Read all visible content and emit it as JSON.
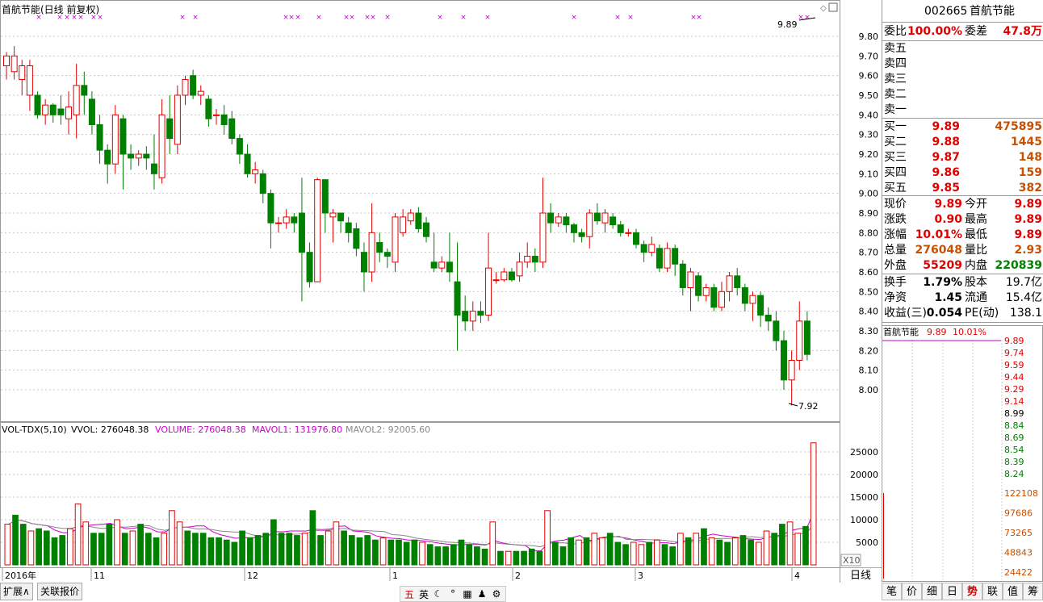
{
  "chart_title": "首航节能(日线 前复权)",
  "stock": {
    "code": "002665",
    "name": "首航节能"
  },
  "weibi": {
    "label": "委比",
    "value": "100.00%",
    "label2": "委差",
    "value2": "47.8万"
  },
  "asks": [
    {
      "label": "卖五"
    },
    {
      "label": "卖四"
    },
    {
      "label": "卖三"
    },
    {
      "label": "卖二"
    },
    {
      "label": "卖一"
    }
  ],
  "bids": [
    {
      "label": "买一",
      "price": "9.89",
      "vol": "475895"
    },
    {
      "label": "买二",
      "price": "9.88",
      "vol": "1445"
    },
    {
      "label": "买三",
      "price": "9.87",
      "vol": "148"
    },
    {
      "label": "买四",
      "price": "9.86",
      "vol": "159"
    },
    {
      "label": "买五",
      "price": "9.85",
      "vol": "382"
    }
  ],
  "quote": [
    {
      "l1": "现价",
      "v1": "9.89",
      "l2": "今开",
      "v2": "9.89"
    },
    {
      "l1": "涨跌",
      "v1": "0.90",
      "l2": "最高",
      "v2": "9.89"
    },
    {
      "l1": "涨幅",
      "v1": "10.01%",
      "l2": "最低",
      "v2": "9.89"
    },
    {
      "l1": "总量",
      "v1": "276048",
      "l2": "量比",
      "v2": "2.93"
    },
    {
      "l1": "外盘",
      "v1": "55209",
      "l2": "内盘",
      "v2": "220839"
    }
  ],
  "fund": [
    {
      "l1": "换手",
      "v1": "1.79%",
      "l2": "股本",
      "v2": "19.7亿"
    },
    {
      "l1": "净资",
      "v1": "1.45",
      "l2": "流通",
      "v2": "15.4亿"
    },
    {
      "l1": "收益(三)",
      "v1": "0.054",
      "l2": "PE(动)",
      "v2": "138.1"
    }
  ],
  "mini": {
    "name": "首航节能",
    "price": "9.89",
    "pct": "10.01%",
    "prices": [
      "9.89",
      "9.74",
      "9.59",
      "9.44",
      "9.29",
      "9.14",
      "8.99",
      "8.84",
      "8.69",
      "8.54",
      "8.39",
      "8.24"
    ],
    "vols": [
      "122108",
      "97686",
      "73265",
      "48843",
      "24422"
    ]
  },
  "vol_legend": {
    "t1": "VOL-TDX(5,10)",
    "t2": "VVOL: 276048.38",
    "t3": "VOLUME: 276048.38",
    "t4": "MAVOL1: 131976.80",
    "t5": "MAVOL2: 92005.60"
  },
  "price_axis": [
    "9.80",
    "9.70",
    "9.60",
    "9.50",
    "9.40",
    "9.30",
    "9.20",
    "9.10",
    "9.00",
    "8.90",
    "8.80",
    "8.70",
    "8.60",
    "8.50",
    "8.40",
    "8.30",
    "8.20",
    "8.10",
    "8.00"
  ],
  "vol_axis": [
    "25000",
    "20000",
    "15000",
    "10000",
    "5000"
  ],
  "vol_unit": "X10",
  "date_labels": [
    "2016年",
    "11",
    "12",
    "1",
    "2",
    "3",
    "4"
  ],
  "annot_high": "9.89",
  "annot_low": "7.92",
  "bottom_tabs": {
    "t1": "扩展∧",
    "t2": "关联报价"
  },
  "right_tabs": [
    "笔",
    "价",
    "细",
    "日",
    "势",
    "联",
    "值",
    "筹"
  ],
  "day_btn": "日线",
  "toolbar": [
    "五",
    "英",
    "☾",
    "°",
    "▦",
    "♟",
    "⚙"
  ],
  "colors": {
    "up": "#e00000",
    "down": "#008000",
    "ma1": "#cc00cc",
    "ma2": "#888888",
    "grid": "#c8c8c8"
  },
  "chart_data": {
    "type": "candlestick",
    "title": "首航节能(日线 前复权)",
    "ylim": [
      7.92,
      9.89
    ],
    "candles": [
      [
        9.65,
        9.7,
        9.72,
        9.58
      ],
      [
        9.62,
        9.7,
        9.75,
        9.58
      ],
      [
        9.58,
        9.65,
        9.68,
        9.5
      ],
      [
        9.5,
        9.65,
        9.68,
        9.42
      ],
      [
        9.5,
        9.4,
        9.52,
        9.38
      ],
      [
        9.4,
        9.45,
        9.48,
        9.35
      ],
      [
        9.45,
        9.4,
        9.46,
        9.36
      ],
      [
        9.43,
        9.4,
        9.5,
        9.35
      ],
      [
        9.38,
        9.44,
        9.52,
        9.3
      ],
      [
        9.4,
        9.55,
        9.66,
        9.28
      ],
      [
        9.55,
        9.5,
        9.62,
        9.4
      ],
      [
        9.48,
        9.35,
        9.52,
        9.3
      ],
      [
        9.35,
        9.22,
        9.4,
        9.15
      ],
      [
        9.22,
        9.15,
        9.25,
        9.05
      ],
      [
        9.15,
        9.4,
        9.45,
        9.1
      ],
      [
        9.38,
        9.2,
        9.4,
        9.02
      ],
      [
        9.2,
        9.18,
        9.25,
        9.12
      ],
      [
        9.18,
        9.2,
        9.22,
        9.14
      ],
      [
        9.2,
        9.18,
        9.24,
        9.12
      ],
      [
        9.15,
        9.1,
        9.3,
        9.02
      ],
      [
        9.08,
        9.4,
        9.48,
        9.05
      ],
      [
        9.38,
        9.28,
        9.5,
        9.2
      ],
      [
        9.25,
        9.5,
        9.55,
        9.2
      ],
      [
        9.5,
        9.58,
        9.6,
        9.45
      ],
      [
        9.6,
        9.5,
        9.63,
        9.48
      ],
      [
        9.5,
        9.52,
        9.55,
        9.45
      ],
      [
        9.48,
        9.38,
        9.5,
        9.34
      ],
      [
        9.4,
        9.4,
        9.43,
        9.35
      ],
      [
        9.4,
        9.35,
        9.45,
        9.3
      ],
      [
        9.38,
        9.28,
        9.42,
        9.25
      ],
      [
        9.28,
        9.2,
        9.3,
        9.15
      ],
      [
        9.2,
        9.1,
        9.25,
        9.08
      ],
      [
        9.1,
        9.12,
        9.16,
        9.05
      ],
      [
        9.1,
        9.0,
        9.12,
        8.95
      ],
      [
        9.0,
        8.85,
        9.02,
        8.72
      ],
      [
        8.85,
        8.85,
        8.88,
        8.8
      ],
      [
        8.85,
        8.88,
        8.92,
        8.82
      ],
      [
        8.88,
        8.85,
        8.9,
        8.8
      ],
      [
        8.9,
        8.7,
        9.08,
        8.45
      ],
      [
        8.7,
        8.55,
        8.75,
        8.52
      ],
      [
        8.55,
        9.07,
        9.08,
        8.55
      ],
      [
        9.07,
        8.9,
        9.05,
        8.8
      ],
      [
        8.88,
        8.9,
        8.92,
        8.75
      ],
      [
        8.9,
        8.86,
        8.9,
        8.8
      ],
      [
        8.85,
        8.8,
        8.88,
        8.75
      ],
      [
        8.82,
        8.72,
        8.85,
        8.68
      ],
      [
        8.7,
        8.6,
        8.75,
        8.5
      ],
      [
        8.6,
        8.8,
        8.95,
        8.55
      ],
      [
        8.75,
        8.7,
        8.8,
        8.65
      ],
      [
        8.7,
        8.68,
        8.72,
        8.62
      ],
      [
        8.65,
        8.88,
        8.9,
        8.6
      ],
      [
        8.8,
        8.88,
        8.92,
        8.78
      ],
      [
        8.86,
        8.9,
        8.92,
        8.84
      ],
      [
        8.9,
        8.82,
        8.93,
        8.8
      ],
      [
        8.85,
        8.78,
        8.88,
        8.75
      ],
      [
        8.65,
        8.62,
        8.8,
        8.6
      ],
      [
        8.62,
        8.65,
        8.68,
        8.6
      ],
      [
        8.65,
        8.6,
        8.8,
        8.55
      ],
      [
        8.55,
        8.38,
        8.75,
        8.2
      ],
      [
        8.4,
        8.35,
        8.48,
        8.3
      ],
      [
        8.35,
        8.4,
        8.45,
        8.3
      ],
      [
        8.4,
        8.38,
        8.45,
        8.34
      ],
      [
        8.38,
        8.62,
        8.8,
        8.35
      ],
      [
        8.56,
        8.56,
        8.6,
        8.54
      ],
      [
        8.56,
        8.6,
        8.62,
        8.55
      ],
      [
        8.6,
        8.56,
        8.62,
        8.55
      ],
      [
        8.58,
        8.65,
        8.7,
        8.55
      ],
      [
        8.65,
        8.68,
        8.75,
        8.62
      ],
      [
        8.68,
        8.65,
        8.72,
        8.6
      ],
      [
        8.65,
        8.9,
        9.08,
        8.62
      ],
      [
        8.9,
        8.85,
        8.95,
        8.8
      ],
      [
        8.85,
        8.88,
        8.9,
        8.83
      ],
      [
        8.88,
        8.84,
        8.9,
        8.8
      ],
      [
        8.84,
        8.8,
        8.85,
        8.75
      ],
      [
        8.8,
        8.78,
        8.82,
        8.75
      ],
      [
        8.78,
        8.9,
        8.92,
        8.72
      ],
      [
        8.9,
        8.86,
        8.95,
        8.84
      ],
      [
        8.85,
        8.9,
        8.92,
        8.8
      ],
      [
        8.88,
        8.84,
        8.9,
        8.82
      ],
      [
        8.84,
        8.8,
        8.86,
        8.78
      ],
      [
        8.8,
        8.8,
        8.82,
        8.78
      ],
      [
        8.8,
        8.74,
        8.82,
        8.72
      ],
      [
        8.74,
        8.7,
        8.76,
        8.65
      ],
      [
        8.7,
        8.74,
        8.78,
        8.68
      ],
      [
        8.72,
        8.62,
        8.74,
        8.6
      ],
      [
        8.62,
        8.72,
        8.75,
        8.6
      ],
      [
        8.72,
        8.64,
        8.74,
        8.58
      ],
      [
        8.64,
        8.52,
        8.66,
        8.48
      ],
      [
        8.52,
        8.6,
        8.62,
        8.4
      ],
      [
        8.58,
        8.48,
        8.6,
        8.45
      ],
      [
        8.48,
        8.52,
        8.54,
        8.45
      ],
      [
        8.52,
        8.42,
        8.54,
        8.4
      ],
      [
        8.42,
        8.5,
        8.55,
        8.4
      ],
      [
        8.5,
        8.58,
        8.6,
        8.45
      ],
      [
        8.58,
        8.52,
        8.62,
        8.48
      ],
      [
        8.52,
        8.44,
        8.54,
        8.4
      ],
      [
        8.44,
        8.48,
        8.5,
        8.35
      ],
      [
        8.48,
        8.38,
        8.5,
        8.32
      ],
      [
        8.38,
        8.35,
        8.42,
        8.3
      ],
      [
        8.35,
        8.25,
        8.4,
        8.2
      ],
      [
        8.25,
        8.05,
        8.3,
        8.0
      ],
      [
        8.05,
        8.15,
        8.2,
        7.92
      ],
      [
        8.15,
        8.35,
        8.45,
        8.1
      ],
      [
        8.35,
        8.18,
        8.4,
        8.15
      ]
    ],
    "volumes": [
      [
        90,
        1
      ],
      [
        110,
        0
      ],
      [
        90,
        0
      ],
      [
        75,
        1
      ],
      [
        80,
        0
      ],
      [
        75,
        0
      ],
      [
        60,
        0
      ],
      [
        65,
        0
      ],
      [
        80,
        1
      ],
      [
        135,
        1
      ],
      [
        95,
        1
      ],
      [
        70,
        0
      ],
      [
        70,
        0
      ],
      [
        90,
        0
      ],
      [
        100,
        1
      ],
      [
        70,
        0
      ],
      [
        75,
        1
      ],
      [
        90,
        0
      ],
      [
        70,
        0
      ],
      [
        60,
        0
      ],
      [
        70,
        1
      ],
      [
        120,
        1
      ],
      [
        95,
        1
      ],
      [
        75,
        0
      ],
      [
        70,
        0
      ],
      [
        70,
        0
      ],
      [
        60,
        0
      ],
      [
        60,
        0
      ],
      [
        55,
        0
      ],
      [
        50,
        0
      ],
      [
        75,
        0
      ],
      [
        60,
        0
      ],
      [
        65,
        0
      ],
      [
        70,
        0
      ],
      [
        100,
        0
      ],
      [
        70,
        0
      ],
      [
        70,
        0
      ],
      [
        65,
        0
      ],
      [
        70,
        1
      ],
      [
        120,
        0
      ],
      [
        65,
        0
      ],
      [
        75,
        1
      ],
      [
        95,
        1
      ],
      [
        75,
        0
      ],
      [
        65,
        0
      ],
      [
        60,
        0
      ],
      [
        65,
        0
      ],
      [
        55,
        0
      ],
      [
        60,
        1
      ],
      [
        55,
        0
      ],
      [
        55,
        0
      ],
      [
        50,
        0
      ],
      [
        55,
        0
      ],
      [
        50,
        1
      ],
      [
        45,
        0
      ],
      [
        40,
        0
      ],
      [
        40,
        0
      ],
      [
        45,
        0
      ],
      [
        55,
        0
      ],
      [
        45,
        0
      ],
      [
        40,
        0
      ],
      [
        35,
        0
      ],
      [
        95,
        1
      ],
      [
        30,
        0
      ],
      [
        30,
        1
      ],
      [
        30,
        0
      ],
      [
        30,
        0
      ],
      [
        35,
        0
      ],
      [
        30,
        0
      ],
      [
        120,
        1
      ],
      [
        50,
        0
      ],
      [
        40,
        0
      ],
      [
        60,
        0
      ],
      [
        55,
        1
      ],
      [
        60,
        0
      ],
      [
        70,
        1
      ],
      [
        60,
        1
      ],
      [
        70,
        0
      ],
      [
        50,
        0
      ],
      [
        45,
        0
      ],
      [
        50,
        1
      ],
      [
        45,
        1
      ],
      [
        50,
        0
      ],
      [
        55,
        1
      ],
      [
        45,
        0
      ],
      [
        40,
        0
      ],
      [
        70,
        1
      ],
      [
        60,
        0
      ],
      [
        70,
        1
      ],
      [
        80,
        0
      ],
      [
        60,
        1
      ],
      [
        55,
        0
      ],
      [
        50,
        0
      ],
      [
        60,
        1
      ],
      [
        65,
        0
      ],
      [
        55,
        0
      ],
      [
        50,
        1
      ],
      [
        75,
        1
      ],
      [
        70,
        0
      ],
      [
        90,
        0
      ],
      [
        95,
        1
      ],
      [
        70,
        1
      ],
      [
        85,
        0
      ],
      [
        270,
        1
      ]
    ]
  }
}
